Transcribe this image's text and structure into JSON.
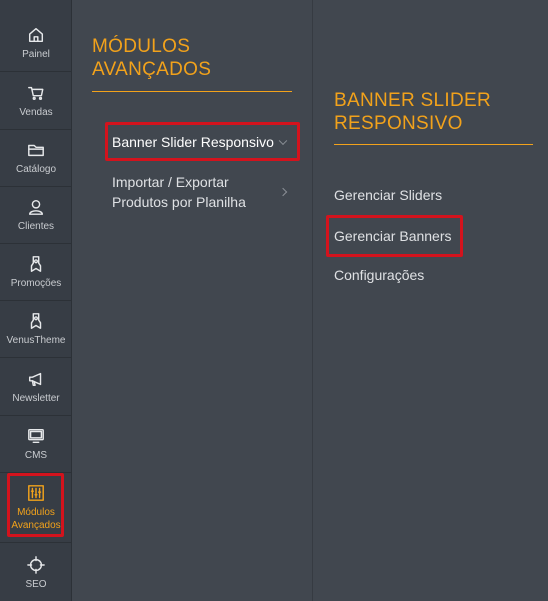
{
  "sidebar": {
    "items": [
      {
        "id": "painel",
        "label": "Painel",
        "icon": "home-icon"
      },
      {
        "id": "vendas",
        "label": "Vendas",
        "icon": "cart-icon"
      },
      {
        "id": "catalogo",
        "label": "Catálogo",
        "icon": "folder-icon"
      },
      {
        "id": "clientes",
        "label": "Clientes",
        "icon": "user-icon"
      },
      {
        "id": "promocoes",
        "label": "Promoções",
        "icon": "badge-icon"
      },
      {
        "id": "venustheme",
        "label": "VenusTheme",
        "icon": "badge-icon"
      },
      {
        "id": "newsletter",
        "label": "Newsletter",
        "icon": "megaphone-icon"
      },
      {
        "id": "cms",
        "label": "CMS",
        "icon": "monitor-icon"
      },
      {
        "id": "modulos",
        "label": "Módulos Avançados",
        "icon": "sliders-icon",
        "active": true
      },
      {
        "id": "seo",
        "label": "SEO",
        "icon": "crosshair-icon"
      }
    ]
  },
  "panel1": {
    "title": "MÓDULOS AVANÇADOS",
    "items": [
      {
        "label": "Banner Slider Responsivo",
        "expanded": true
      },
      {
        "label": "Importar / Exportar Produtos por Planilha",
        "expanded": false
      }
    ]
  },
  "panel2": {
    "title": "BANNER SLIDER RESPONSIVO",
    "items": [
      {
        "label": "Gerenciar Sliders"
      },
      {
        "label": "Gerenciar Banners"
      },
      {
        "label": "Configurações"
      }
    ]
  },
  "colors": {
    "accent": "#f2a21b",
    "highlight": "#d3131d",
    "sidebar_bg": "#373d45",
    "panel_bg": "#41474f"
  }
}
